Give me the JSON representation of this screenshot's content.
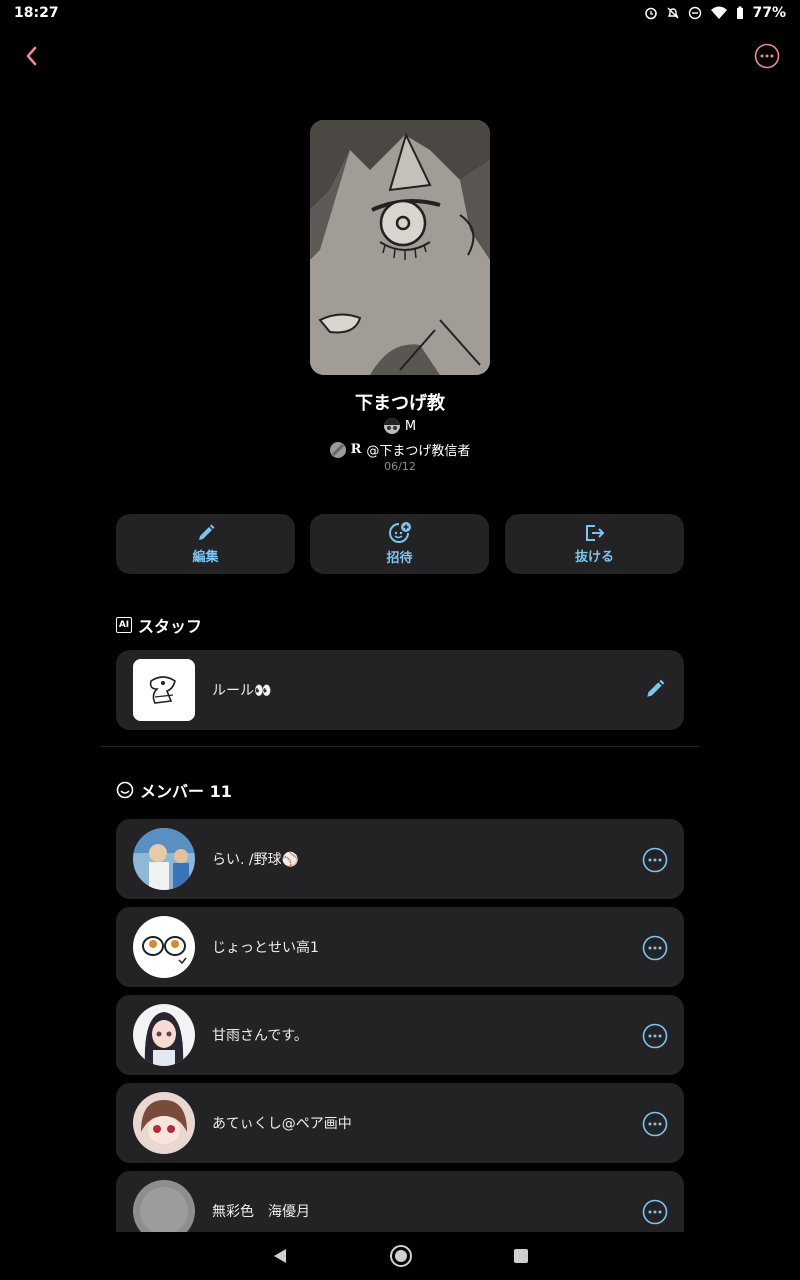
{
  "status": {
    "time": "18:27",
    "battery": "77%"
  },
  "group": {
    "title": "下まつげ教",
    "owner_name": "M",
    "admin_mark": "R",
    "admin_handle": "@下まつげ教信者",
    "date": "06/12"
  },
  "actions": [
    {
      "label": "編集",
      "icon": "pencil-icon"
    },
    {
      "label": "招待",
      "icon": "add-friend-icon"
    },
    {
      "label": "抜ける",
      "icon": "exit-icon"
    }
  ],
  "staff": {
    "heading": "スタッフ",
    "heading_icon": "AI",
    "items": [
      {
        "name": "ルール👀"
      }
    ]
  },
  "members": {
    "heading": "メンバー 11",
    "items": [
      {
        "name": "らい. /野球⚾"
      },
      {
        "name": "じょっとせい高1"
      },
      {
        "name": "甘雨さんです。"
      },
      {
        "name": "あてぃくし@ペア画中"
      },
      {
        "name": "無彩色　海優月"
      }
    ]
  },
  "colors": {
    "accent_blue": "#7ec4ee",
    "back_pink": "#e88a9a",
    "card_bg": "#232325"
  }
}
